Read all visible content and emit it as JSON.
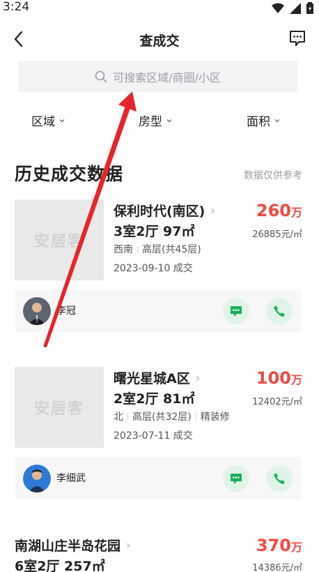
{
  "status": {
    "time": "3:24"
  },
  "nav": {
    "title": "查成交"
  },
  "search": {
    "placeholder": "可搜索区域/商圈/小区"
  },
  "filters": [
    {
      "label": "区域"
    },
    {
      "label": "房型"
    },
    {
      "label": "面积"
    }
  ],
  "section": {
    "title": "历史成交数据",
    "note": "数据仅供参考"
  },
  "listings": [
    {
      "watermark": "安居客",
      "name": "保利时代(南区)",
      "layout": "3室2厅 97㎡",
      "tags": [
        "西南",
        "高层(共45层)"
      ],
      "date": "2023-09-10 成交",
      "price": "260",
      "price_unit": "万",
      "unit_price": "26885元/㎡",
      "agent": {
        "name": "李冠"
      }
    },
    {
      "watermark": "安居客",
      "name": "曙光星城A区",
      "layout": "2室2厅 81㎡",
      "tags": [
        "北",
        "高层(共32层)",
        "精装修"
      ],
      "date": "2023-07-11 成交",
      "price": "100",
      "price_unit": "万",
      "unit_price": "12402元/㎡",
      "agent": {
        "name": "李细武"
      }
    },
    {
      "name": "南湖山庄半岛花园",
      "layout": "6室2厅 257㎡",
      "price": "370",
      "price_unit": "万",
      "unit_price": "14386元/㎡"
    }
  ],
  "colors": {
    "price": "#f2493f",
    "action_bg": "#e1f4e8",
    "action_icon": "#18b15a",
    "annotation_arrow": "#e8242c"
  },
  "icons": [
    "back-icon",
    "message-icon",
    "search-icon",
    "chevron-down-icon",
    "chevron-right-icon",
    "chat-icon",
    "phone-icon",
    "wifi-icon",
    "signal-icon",
    "battery-icon"
  ]
}
